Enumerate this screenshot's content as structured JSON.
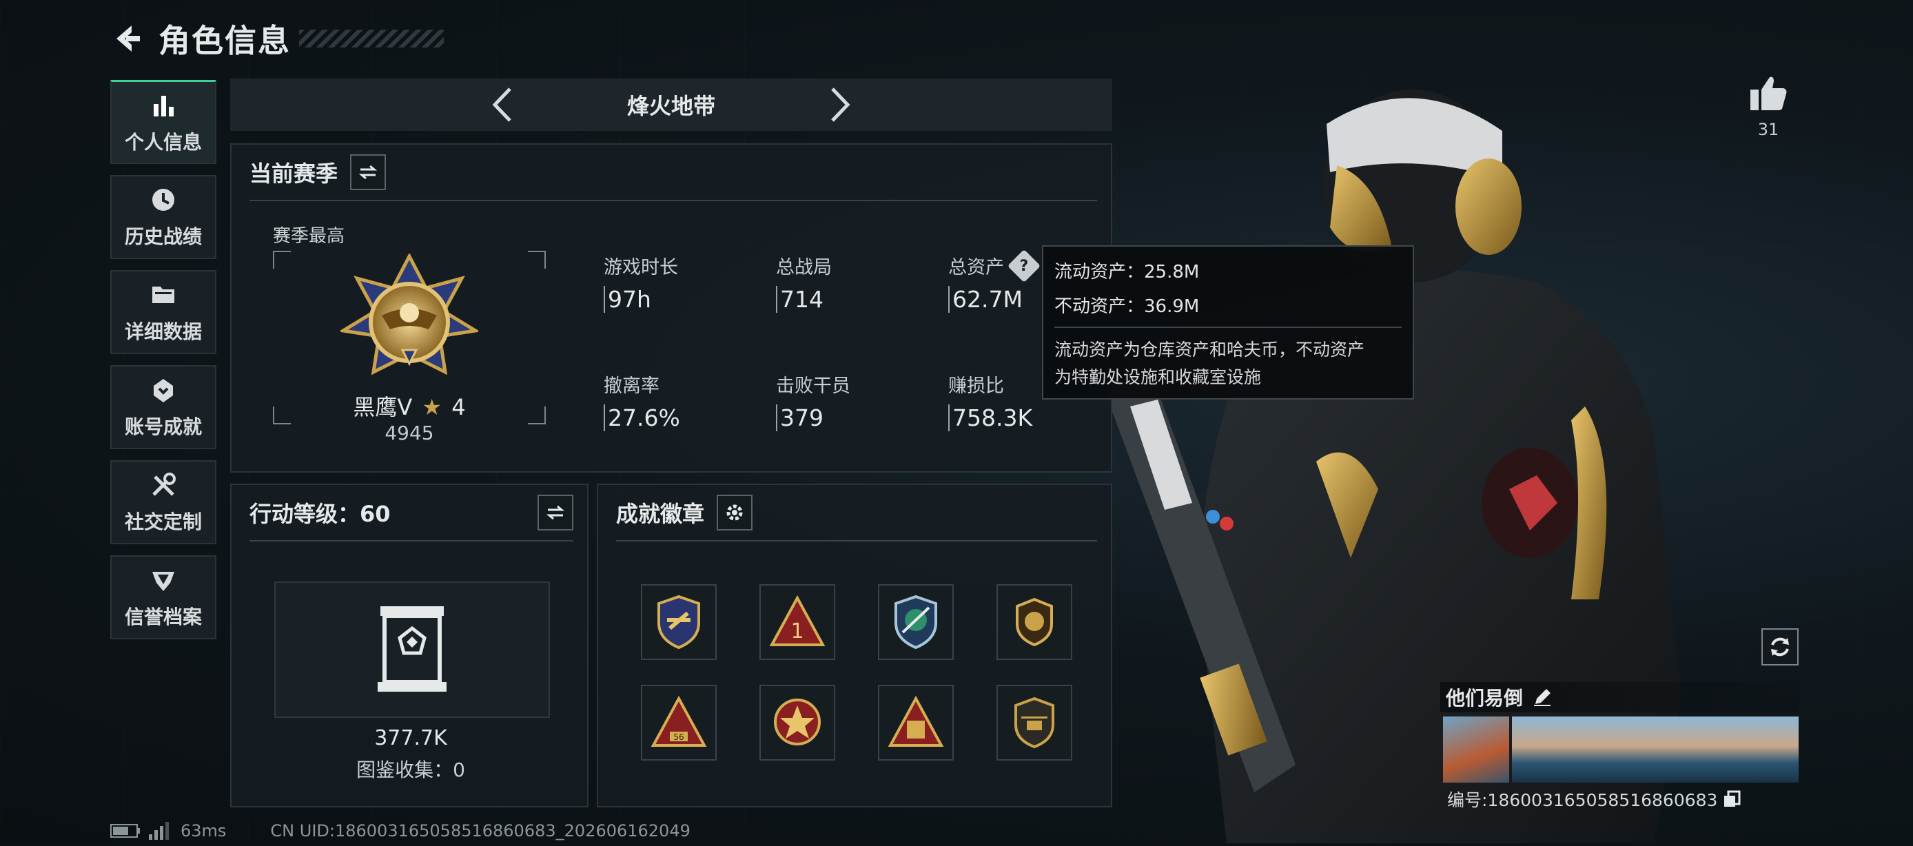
{
  "header": {
    "title": "角色信息"
  },
  "sidebar": {
    "items": [
      {
        "label": "个人信息",
        "icon": "bar-chart-icon",
        "active": true
      },
      {
        "label": "历史战绩",
        "icon": "clock-icon"
      },
      {
        "label": "详细数据",
        "icon": "folder-icon"
      },
      {
        "label": "账号成就",
        "icon": "achievement-icon"
      },
      {
        "label": "社交定制",
        "icon": "tools-icon"
      },
      {
        "label": "信誉档案",
        "icon": "shield-icon"
      }
    ]
  },
  "mode_tabs": {
    "current": "烽火地带"
  },
  "season": {
    "title": "当前赛季",
    "best_label": "赛季最高",
    "rank_name": "黑鹰V",
    "rank_stars": "4",
    "rank_score": "4945",
    "stats": [
      {
        "label": "游戏时长",
        "value": "97h"
      },
      {
        "label": "总战局",
        "value": "714"
      },
      {
        "label": "总资产",
        "value": "62.7M"
      },
      {
        "label": "撤离率",
        "value": "27.6%"
      },
      {
        "label": "击败干员",
        "value": "379"
      },
      {
        "label": "赚损比",
        "value": "758.3K"
      }
    ]
  },
  "tooltip": {
    "liquid": "流动资产：25.8M",
    "fixed": "不动资产：36.9M",
    "note_line1": "流动资产为仓库资产和哈夫币，不动资产",
    "note_line2": "为特勤处设施和收藏室设施"
  },
  "action_level": {
    "title": "行动等级：60",
    "collection_value": "377.7K",
    "collection_label": "图鉴收集：0"
  },
  "achievements": {
    "title": "成就徽章",
    "badges": [
      "badge-1",
      "badge-2",
      "badge-3",
      "badge-4",
      "badge-5",
      "badge-6",
      "badge-7",
      "badge-8"
    ]
  },
  "likes": {
    "count": "31"
  },
  "name_card": {
    "name": "他们易倒",
    "id_line": "编号:18600316505851686​0683"
  },
  "footer": {
    "ping": "63ms",
    "uid": "CN UID:18600316505851686​0683_202606162049"
  },
  "colors": {
    "accent": "#3fcf9b",
    "panel": "#161d22",
    "border": "#2b3439",
    "gold": "#c9a24a"
  }
}
